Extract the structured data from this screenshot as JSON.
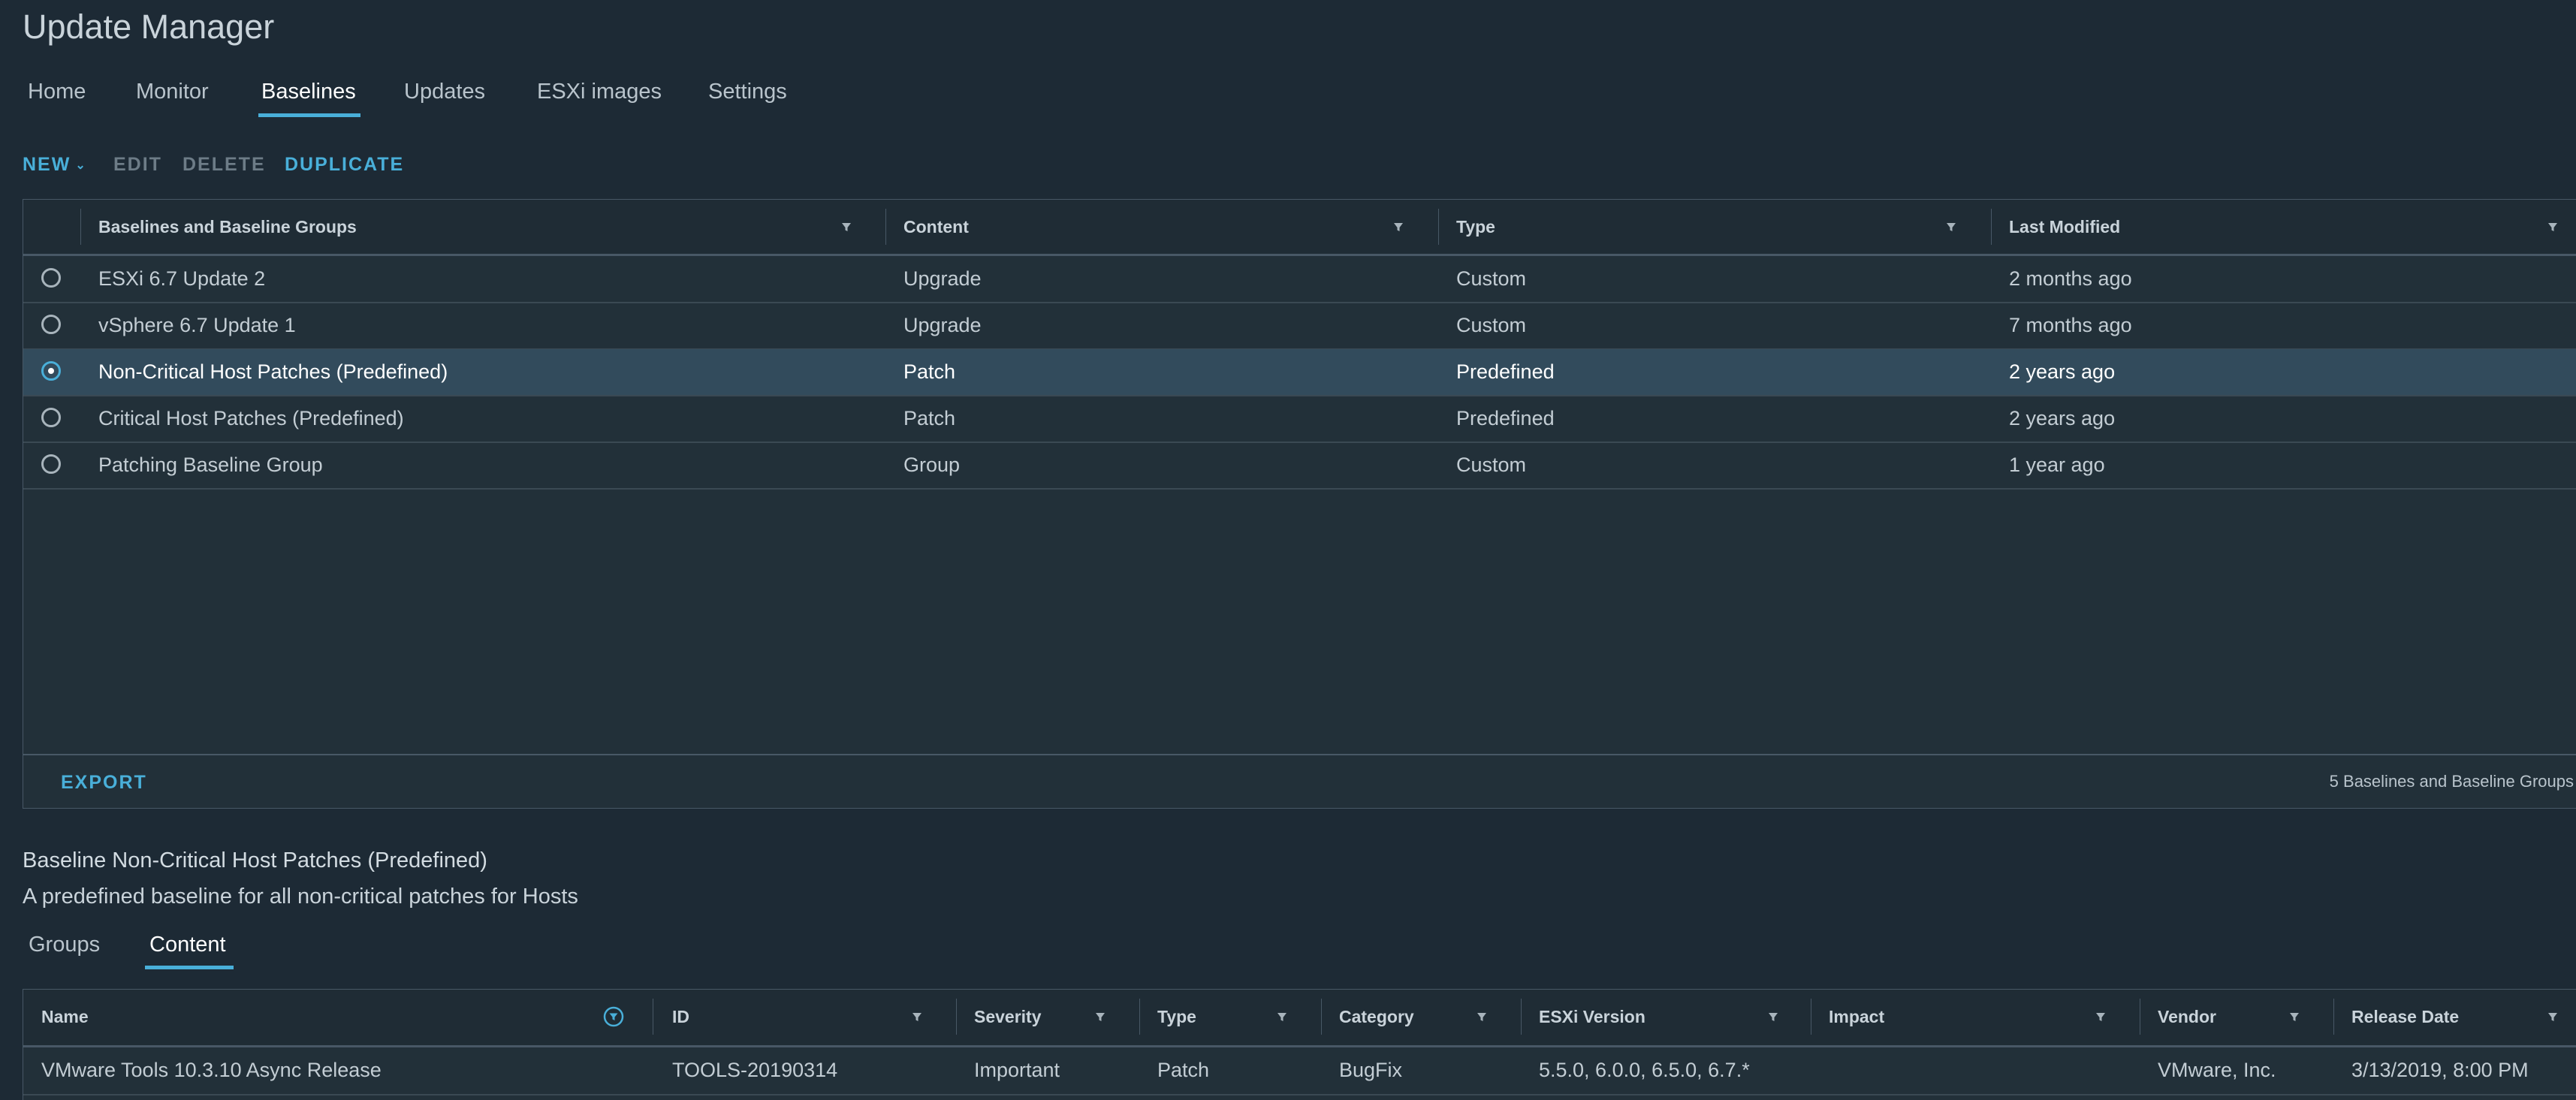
{
  "app": {
    "title": "Update Manager"
  },
  "nav": {
    "tabs": [
      {
        "label": "Home"
      },
      {
        "label": "Monitor"
      },
      {
        "label": "Baselines"
      },
      {
        "label": "Updates"
      },
      {
        "label": "ESXi images"
      },
      {
        "label": "Settings"
      }
    ],
    "active": "Baselines"
  },
  "actions": {
    "new": "NEW",
    "edit": "EDIT",
    "delete": "DELETE",
    "duplicate": "DUPLICATE"
  },
  "baselines": {
    "columns": [
      "Baselines and Baseline Groups",
      "Content",
      "Type",
      "Last Modified"
    ],
    "rows": [
      {
        "name": "ESXi 6.7 Update 2",
        "content": "Upgrade",
        "type": "Custom",
        "modified": "2 months ago",
        "selected": false
      },
      {
        "name": "vSphere 6.7 Update 1",
        "content": "Upgrade",
        "type": "Custom",
        "modified": "7 months ago",
        "selected": false
      },
      {
        "name": "Non-Critical Host Patches (Predefined)",
        "content": "Patch",
        "type": "Predefined",
        "modified": "2 years ago",
        "selected": true
      },
      {
        "name": "Critical Host Patches (Predefined)",
        "content": "Patch",
        "type": "Predefined",
        "modified": "2 years ago",
        "selected": false
      },
      {
        "name": "Patching Baseline Group",
        "content": "Group",
        "type": "Custom",
        "modified": "1 year ago",
        "selected": false
      }
    ],
    "export_label": "EXPORT",
    "count_label": "5 Baselines and Baseline Groups"
  },
  "detail": {
    "title": "Baseline Non-Critical Host Patches (Predefined)",
    "description": "A predefined baseline for all non-critical patches for Hosts",
    "tabs": [
      {
        "label": "Groups"
      },
      {
        "label": "Content"
      }
    ],
    "active_tab": "Content",
    "columns": [
      "Name",
      "ID",
      "Severity",
      "Type",
      "Category",
      "ESXi Version",
      "Impact",
      "Vendor",
      "Release Date"
    ],
    "rows": [
      {
        "name": "VMware Tools 10.3.10 Async Release",
        "id": "TOOLS-20190314",
        "severity": "Important",
        "type": "Patch",
        "category": "BugFix",
        "esxi": "5.5.0, 6.0.0, 6.5.0, 6.7.*",
        "impact": "",
        "vendor": "VMware, Inc.",
        "release": "3/13/2019, 8:00 PM"
      }
    ]
  },
  "colors": {
    "accent": "#49afd9",
    "background": "#1d2a35"
  },
  "icons": {
    "filter": "filter-icon",
    "filter_active": "filter-active-icon",
    "dropdown": "chevron-down-icon"
  }
}
